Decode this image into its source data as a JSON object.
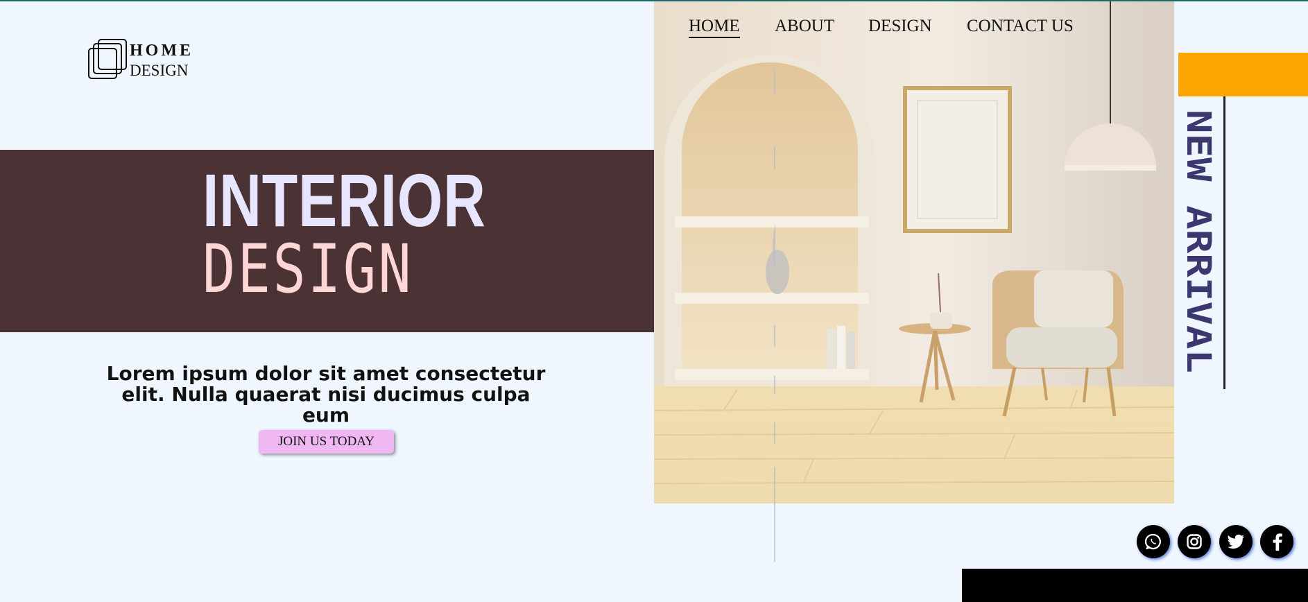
{
  "logo": {
    "line1": "HOME",
    "line2": "DESIGN"
  },
  "nav": [
    {
      "label": "HOME",
      "active": true
    },
    {
      "label": "ABOUT",
      "active": false
    },
    {
      "label": "DESIGN",
      "active": false
    },
    {
      "label": "CONTACT US",
      "active": false
    }
  ],
  "hero": {
    "title_line1": "INTERIOR",
    "title_line2": "DESIGN",
    "tagline_line1": "Lorem ipsum dolor sit amet consectetur",
    "tagline_line2": "elit. Nulla quaerat nisi ducimus culpa eum",
    "cta_label": "JOIN US TODAY"
  },
  "watermark_text": "HOME",
  "side_banner": {
    "label": "NEW ARRIVAL"
  },
  "social_icons": [
    "whatsapp-icon",
    "instagram-icon",
    "twitter-icon",
    "facebook-icon"
  ],
  "colors": {
    "page_bg": "#eff6fe",
    "hero_band": "#4b3335",
    "title_primary": "#e8e6ff",
    "title_secondary": "#ffd6d6",
    "cta_bg": "#f0b8f2",
    "accent_orange": "#ffa500",
    "banner_text": "#3b3870",
    "watermark": "#b8bdc5"
  }
}
